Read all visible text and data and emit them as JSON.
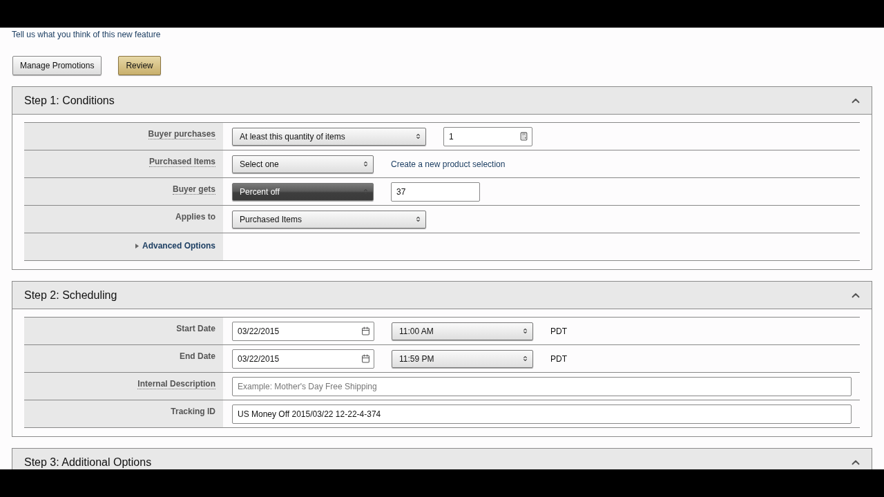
{
  "feedback_link": "Tell us what you think of this new feature",
  "buttons": [
    {
      "label": "Manage Promotions",
      "kind": "default"
    },
    {
      "label": "Review",
      "kind": "primary"
    }
  ],
  "sections": [
    {
      "title": "Step 1: Conditions",
      "expanded": true,
      "rows": [
        {
          "label": "Buyer purchases",
          "dotted": true,
          "controls": [
            {
              "kind": "select",
              "value": "At least this quantity of items",
              "active": false
            },
            {
              "kind": "number",
              "value": "1"
            }
          ]
        },
        {
          "label": "Purchased Items",
          "dotted": true,
          "controls": [
            {
              "kind": "select",
              "value": "Select one",
              "active": false
            },
            {
              "kind": "link",
              "value": "Create a new product selection"
            }
          ]
        },
        {
          "label": "Buyer gets",
          "dotted": true,
          "controls": [
            {
              "kind": "select",
              "value": "Percent off",
              "active": true
            },
            {
              "kind": "text",
              "value": "37"
            }
          ]
        },
        {
          "label": "Applies to",
          "dotted": false,
          "controls": [
            {
              "kind": "select",
              "value": "Purchased Items",
              "active": false
            }
          ]
        },
        {
          "label": "Advanced Options",
          "kind": "toggle",
          "expanded": false,
          "controls": []
        }
      ]
    },
    {
      "title": "Step 2: Scheduling",
      "expanded": true,
      "rows": [
        {
          "label": "Start Date",
          "dotted": false,
          "controls": [
            {
              "kind": "date",
              "value": "03/22/2015"
            },
            {
              "kind": "select",
              "value": "11:00 AM",
              "active": false
            },
            {
              "kind": "zone",
              "value": "PDT"
            }
          ]
        },
        {
          "label": "End Date",
          "dotted": false,
          "controls": [
            {
              "kind": "date",
              "value": "03/22/2015"
            },
            {
              "kind": "select",
              "value": "11:59 PM",
              "active": false
            },
            {
              "kind": "zone",
              "value": "PDT"
            }
          ]
        },
        {
          "label": "Internal Description",
          "dotted": true,
          "controls": [
            {
              "kind": "wide",
              "placeholder": "Example: Mother's Day Free Shipping"
            }
          ]
        },
        {
          "label": "Tracking ID",
          "dotted": false,
          "controls": [
            {
              "kind": "wide",
              "value": "US Money Off 2015/03/22 12-22-4-374"
            }
          ]
        }
      ]
    },
    {
      "title": "Step 3: Additional Options",
      "expanded": true
    }
  ]
}
